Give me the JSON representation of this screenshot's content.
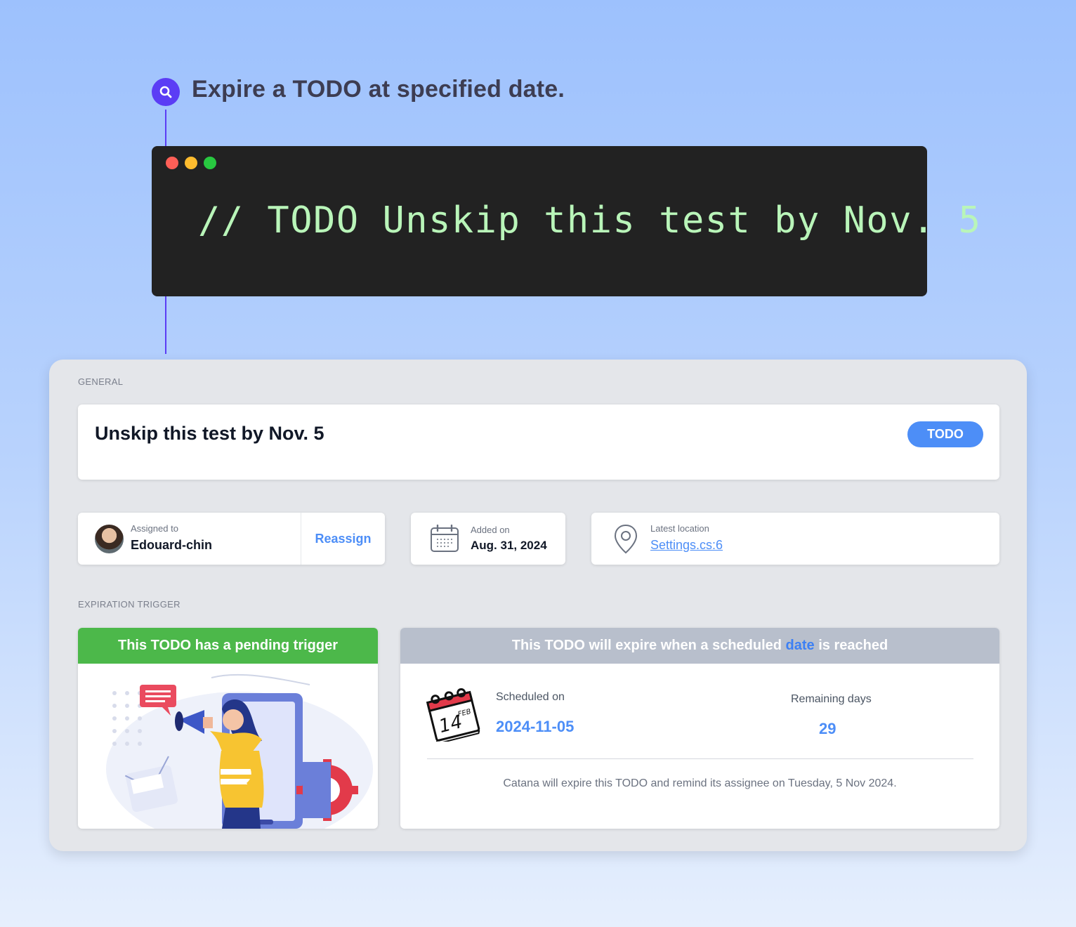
{
  "header": {
    "icon": "search-icon",
    "text": "Expire a TODO at specified date."
  },
  "code": {
    "line": "// TODO Unskip this test by Nov. 5",
    "text_color": "#b9f5b9"
  },
  "general": {
    "section_label": "GENERAL",
    "title": "Unskip this test by Nov. 5",
    "badge": "TODO"
  },
  "assignee": {
    "label": "Assigned to",
    "name": "Edouard-chin",
    "action": "Reassign"
  },
  "added": {
    "label": "Added on",
    "date": "Aug. 31, 2024"
  },
  "location": {
    "label": "Latest location",
    "link": "Settings.cs:6"
  },
  "expiration": {
    "section_label": "EXPIRATION TRIGGER",
    "pending_header": "This TODO has a pending trigger",
    "expire_header_pre": "This TODO will expire when a scheduled ",
    "expire_header_highlight": "date",
    "expire_header_post": " is reached",
    "calendar_day": "14",
    "calendar_month": "FEB",
    "scheduled_label": "Scheduled on",
    "scheduled_value": "2024-11-05",
    "remaining_label": "Remaining days",
    "remaining_value": "29",
    "footnote": "Catana will expire this TODO and remind its assignee on Tuesday, 5 Nov 2024."
  },
  "colors": {
    "accent": "#4d8ef7",
    "brand_purple": "#5b3df5",
    "success_green": "#4cb84a",
    "muted_header": "#b8bfcc"
  }
}
